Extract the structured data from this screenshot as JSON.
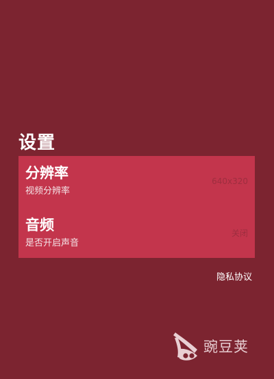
{
  "title": "设置",
  "settings": [
    {
      "title": "分辨率",
      "subtitle": "视频分辨率",
      "value": "640x320"
    },
    {
      "title": "音频",
      "subtitle": "是否开启声音",
      "value": "关闭"
    }
  ],
  "privacy_link": "隐私协议",
  "logo": {
    "icon": "wandoujia-pea-pod-icon",
    "text": "豌豆荚"
  },
  "colors": {
    "background": "#7c2430",
    "panel": "#c3354c",
    "value_text": "#9e2e3f",
    "logo_text": "#e9cfd3"
  }
}
